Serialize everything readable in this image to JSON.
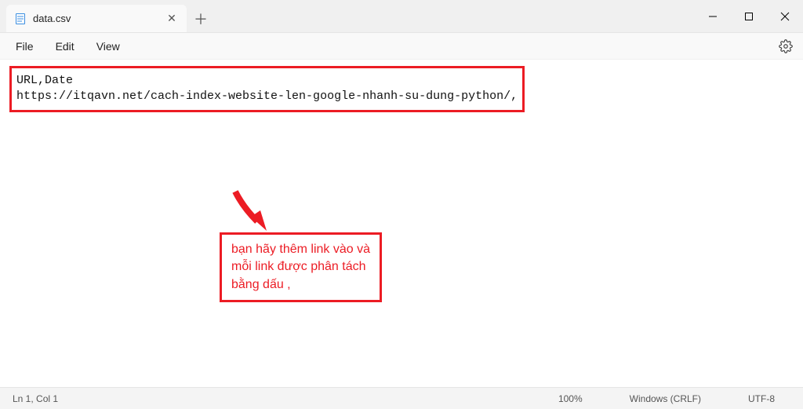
{
  "tab": {
    "title": "data.csv"
  },
  "menu": {
    "file": "File",
    "edit": "Edit",
    "view": "View"
  },
  "file_content": {
    "line1": "URL,Date",
    "line2": "https://itqavn.net/cach-index-website-len-google-nhanh-su-dung-python/,"
  },
  "callout": {
    "line1": "bạn hãy thêm link vào và",
    "line2": "mỗi link được phân tách",
    "line3": "bằng dấu ,"
  },
  "status": {
    "position": "Ln 1, Col 1",
    "zoom": "100%",
    "line_ending": "Windows (CRLF)",
    "encoding": "UTF-8"
  }
}
